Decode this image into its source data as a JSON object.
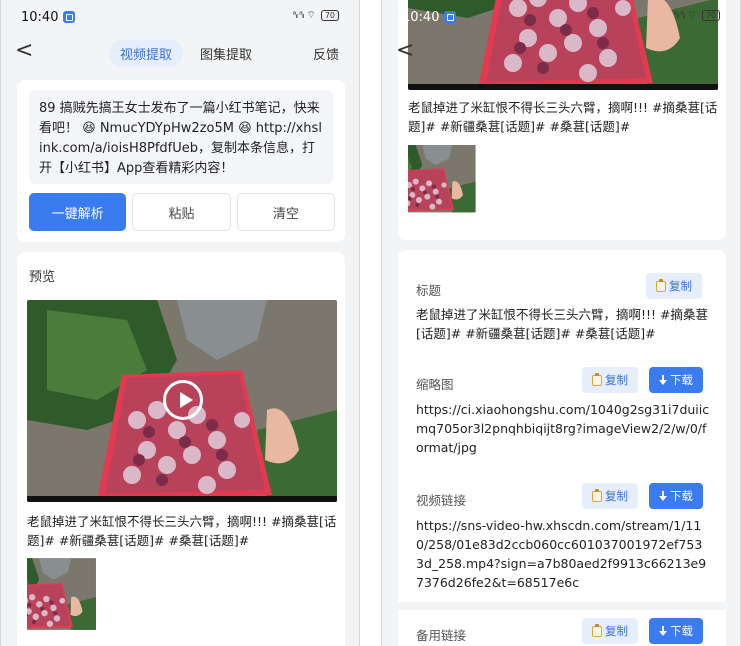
{
  "status": {
    "time": "10:40",
    "signal": "ᶜᴸᵀ",
    "battery": "70"
  },
  "nav": {
    "back": "<",
    "tabs": [
      "视频提取",
      "图集提取"
    ],
    "feedback": "反馈"
  },
  "input": {
    "text": "89 搞贼先搞王女士发布了一篇小红书笔记，快来看吧！ 😆 NmucYDYpHw2zo5M 😆 http://xhslink.com/a/ioisH8PfdfUeb，复制本条信息，打开【小红书】App查看精彩内容！",
    "parse_label": "一键解析",
    "paste_label": "粘贴",
    "clear_label": "清空"
  },
  "preview": {
    "label": "预览",
    "description": "老鼠掉进了米缸恨不得长三头六臂，摘啊!!! #摘桑葚[话题]# #新疆桑葚[话题]# #桑葚[话题]#"
  },
  "details": {
    "copy_label": "复制",
    "download_label": "下载",
    "title_label": "标题",
    "title_value": "老鼠掉进了米缸恨不得长三头六臂，摘啊!!! #摘桑葚[话题]# #新疆桑葚[话题]# #桑葚[话题]#",
    "thumb_label": "缩略图",
    "thumb_value": "https://ci.xiaohongshu.com/1040g2sg31i7duiicmq705or3l2pnqhbiqijt8rg?imageView2/2/w/0/format/jpg",
    "video_label": "视频链接",
    "video_value": "https://sns-video-hw.xhscdn.com/stream/1/110/258/01e83d2ccb060cc601037001972ef7533d_258.mp4?sign=a7b80aed2f9913c66213e97376d26fe2&t=68517e6c",
    "backup_label": "备用链接"
  },
  "colors": {
    "accent": "#3a7bf0",
    "accent_light": "#e6eefc",
    "background": "#f3f4f6"
  }
}
